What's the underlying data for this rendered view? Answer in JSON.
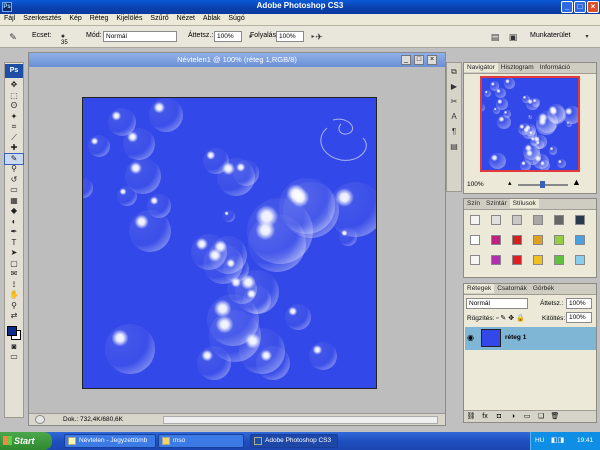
{
  "window": {
    "title": "Adobe Photoshop CS3",
    "app_icon": "Ps"
  },
  "menu": [
    "Fájl",
    "Szerkesztés",
    "Kép",
    "Réteg",
    "Kijelölés",
    "Szűrő",
    "Nézet",
    "Ablak",
    "Súgó"
  ],
  "options": {
    "brush_label": "Ecset:",
    "brush_size": "35",
    "mode_label": "Mód:",
    "mode_value": "Normál",
    "opacity_label": "Áttetsz.:",
    "opacity_value": "100%",
    "flow_label": "Folyalás:",
    "flow_value": "100%",
    "workspace_label": "Munkaterület"
  },
  "toolbox": {
    "logo": "Ps"
  },
  "document": {
    "title": "Névtelen1 @ 100% (réteg 1,RGB/8)",
    "status": "Dok.: 732,4K/680,6K",
    "canvas_color": "#3348e8"
  },
  "navigator": {
    "tabs": [
      "Navigátor",
      "Hisztogram",
      "Információ"
    ],
    "zoom": "100%"
  },
  "styles": {
    "tabs": [
      "Szín",
      "Színtár",
      "Stílusok"
    ]
  },
  "layers": {
    "tabs": [
      "Rétegek",
      "Csatornák",
      "Görbék"
    ],
    "blend_mode": "Normál",
    "opacity_label": "Áttetsz.:",
    "opacity_value": "100%",
    "lock_label": "Rögzítés:",
    "fill_label": "Kitöltés:",
    "fill_value": "100%",
    "layer_name": "réteg 1"
  },
  "taskbar": {
    "start": "Start",
    "items": [
      "Névtelen - Jegyzettömb",
      "mso",
      "Adobe Photoshop CS3"
    ],
    "lang": "HU",
    "clock": "19:41"
  },
  "colors": {
    "accent": "#0a3aa0",
    "foreground": "#0a2b8a",
    "background": "#ffffff"
  }
}
